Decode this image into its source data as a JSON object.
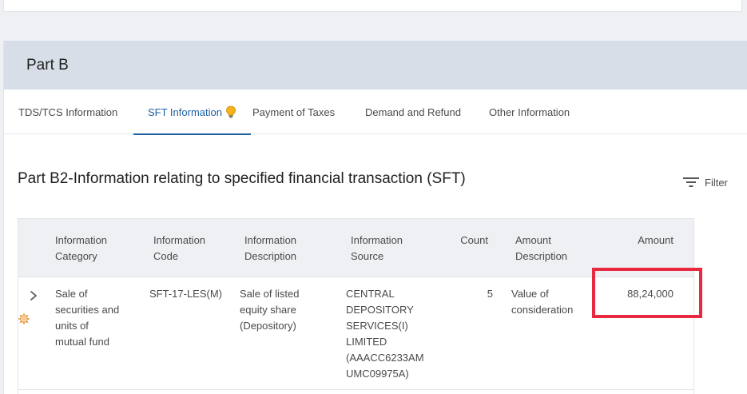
{
  "part": {
    "title": "Part B"
  },
  "tabs": [
    {
      "label": "TDS/TCS Information"
    },
    {
      "label": "SFT Information",
      "active": true
    },
    {
      "label": "Payment of Taxes"
    },
    {
      "label": "Demand and Refund"
    },
    {
      "label": "Other Information"
    }
  ],
  "section": {
    "title": "Part B2-Information relating to specified financial transaction (SFT)",
    "filter_label": "Filter"
  },
  "table": {
    "headers": {
      "category": [
        "Information",
        "Category"
      ],
      "code": [
        "Information",
        "Code"
      ],
      "description": [
        "Information",
        "Description"
      ],
      "source": [
        "Information",
        "Source"
      ],
      "count": [
        "Count"
      ],
      "amount_description": [
        "Amount",
        "Description"
      ],
      "amount": [
        "Amount"
      ]
    },
    "rows": [
      {
        "category": [
          "Sale of",
          "securities and",
          "units of",
          "mutual fund"
        ],
        "code": [
          "SFT-17-LES(M)"
        ],
        "description": [
          "Sale of listed",
          "equity share",
          "(Depository)"
        ],
        "source": [
          "CENTRAL",
          "DEPOSITORY",
          "SERVICES(I)",
          "LIMITED",
          "(AAACC6233AM",
          "UMC09975A)"
        ],
        "count": [
          "5"
        ],
        "amount_description": [
          "Value of",
          "consideration"
        ],
        "amount": [
          "88,24,000"
        ]
      }
    ]
  },
  "colors": {
    "accent": "#1e5fa3",
    "highlight": "#e8293f",
    "header_band": "#d8dee8",
    "bulb": "#f5b21a",
    "gear": "#e8902a"
  },
  "icons": {
    "bulb": "lightbulb-icon",
    "filter": "filter-icon",
    "expand": "chevron-right-icon",
    "gear": "gear-icon"
  }
}
